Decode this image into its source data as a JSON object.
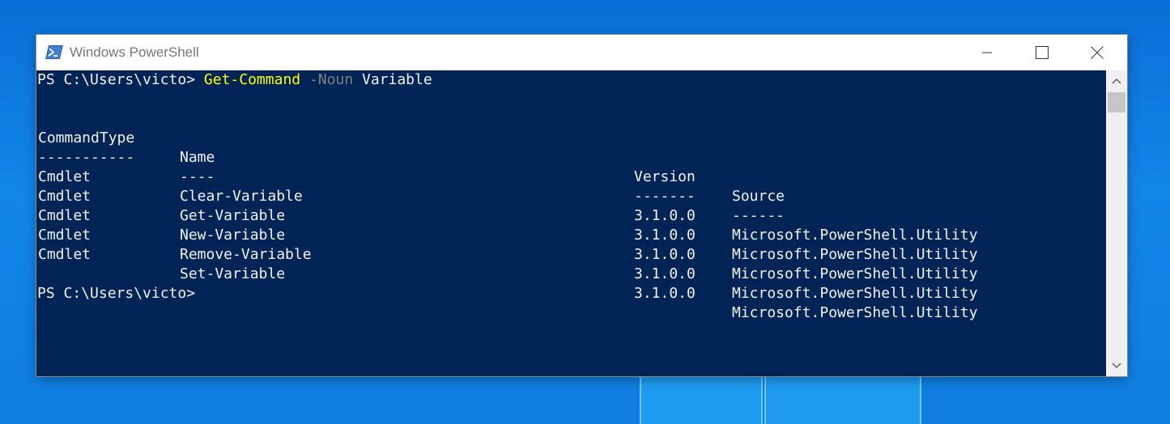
{
  "window": {
    "title": "Windows PowerShell",
    "icon": "powershell-icon",
    "controls": [
      "minimize-icon",
      "maximize-icon",
      "close-icon"
    ]
  },
  "console": {
    "prompt": "PS C:\\Users\\victo> ",
    "command": {
      "cmdlet": "Get-Command",
      "parameter": "-Noun",
      "argument": "Variable"
    },
    "table": {
      "headers": [
        "CommandType",
        "Name",
        "Version",
        "Source"
      ],
      "separators": [
        "-----------",
        "----",
        "-------",
        "------"
      ],
      "rows": [
        [
          "Cmdlet",
          "Clear-Variable",
          "3.1.0.0",
          "Microsoft.PowerShell.Utility"
        ],
        [
          "Cmdlet",
          "Get-Variable",
          "3.1.0.0",
          "Microsoft.PowerShell.Utility"
        ],
        [
          "Cmdlet",
          "New-Variable",
          "3.1.0.0",
          "Microsoft.PowerShell.Utility"
        ],
        [
          "Cmdlet",
          "Remove-Variable",
          "3.1.0.0",
          "Microsoft.PowerShell.Utility"
        ],
        [
          "Cmdlet",
          "Set-Variable",
          "3.1.0.0",
          "Microsoft.PowerShell.Utility"
        ]
      ]
    },
    "final_prompt": "PS C:\\Users\\victo>"
  },
  "colors": {
    "console_bg": "#012456",
    "command_color": "#ffff00",
    "parameter_color": "#808080",
    "text_color": "#f2f2f2",
    "desktop_bg": "#0e7ee0"
  }
}
